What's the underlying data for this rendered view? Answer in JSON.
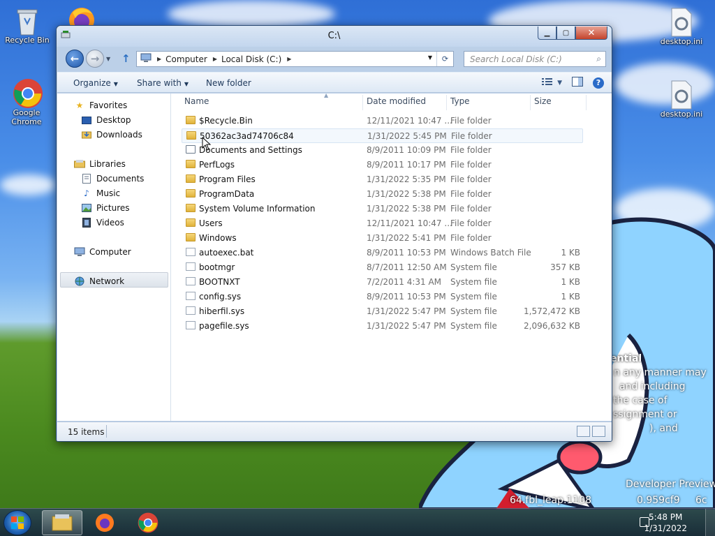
{
  "desktop": {
    "icons": [
      {
        "label": "Recycle Bin"
      },
      {
        "label": "Google Chrome"
      },
      {
        "label": "desktop.ini"
      },
      {
        "label": "desktop.ini"
      }
    ],
    "watermark": {
      "line1": "ential",
      "line2": "n any manner may",
      "line3": "and including",
      "line4": "the case of",
      "line5": "ssignment or",
      "line6": "), and",
      "line7": "Developer Preview",
      "line8": "64.fbl_leap.1108",
      "line9": "0.959cf9",
      "line10": "6c"
    }
  },
  "window": {
    "title": "C:\\",
    "address": {
      "crumbs": [
        "Computer",
        "Local Disk (C:)"
      ]
    },
    "search_placeholder": "Search Local Disk (C:)",
    "toolbar": {
      "organize": "Organize",
      "share_with": "Share with",
      "new_folder": "New folder"
    },
    "nav": {
      "favorites": "Favorites",
      "desktop": "Desktop",
      "downloads": "Downloads",
      "libraries": "Libraries",
      "documents": "Documents",
      "music": "Music",
      "pictures": "Pictures",
      "videos": "Videos",
      "computer": "Computer",
      "network": "Network"
    },
    "columns": {
      "name": "Name",
      "date": "Date modified",
      "type": "Type",
      "size": "Size"
    },
    "files": [
      {
        "name": "$Recycle.Bin",
        "date": "12/11/2021 10:47 ...",
        "type": "File folder",
        "size": "",
        "kind": "folder"
      },
      {
        "name": "50362ac3ad74706c84",
        "date": "1/31/2022 5:45 PM",
        "type": "File folder",
        "size": "",
        "kind": "folder"
      },
      {
        "name": "Documents and Settings",
        "date": "8/9/2011 10:09 PM",
        "type": "File folder",
        "size": "",
        "kind": "shortcut"
      },
      {
        "name": "PerfLogs",
        "date": "8/9/2011 10:17 PM",
        "type": "File folder",
        "size": "",
        "kind": "folder"
      },
      {
        "name": "Program Files",
        "date": "1/31/2022 5:35 PM",
        "type": "File folder",
        "size": "",
        "kind": "folder"
      },
      {
        "name": "ProgramData",
        "date": "1/31/2022 5:38 PM",
        "type": "File folder",
        "size": "",
        "kind": "folder"
      },
      {
        "name": "System Volume Information",
        "date": "1/31/2022 5:38 PM",
        "type": "File folder",
        "size": "",
        "kind": "folder"
      },
      {
        "name": "Users",
        "date": "12/11/2021 10:47 ...",
        "type": "File folder",
        "size": "",
        "kind": "folder"
      },
      {
        "name": "Windows",
        "date": "1/31/2022 5:41 PM",
        "type": "File folder",
        "size": "",
        "kind": "folder"
      },
      {
        "name": "autoexec.bat",
        "date": "8/9/2011 10:53 PM",
        "type": "Windows Batch File",
        "size": "1 KB",
        "kind": "file"
      },
      {
        "name": "bootmgr",
        "date": "8/7/2011 12:50 AM",
        "type": "System file",
        "size": "357 KB",
        "kind": "file"
      },
      {
        "name": "BOOTNXT",
        "date": "7/2/2011 4:31 AM",
        "type": "System file",
        "size": "1 KB",
        "kind": "file"
      },
      {
        "name": "config.sys",
        "date": "8/9/2011 10:53 PM",
        "type": "System file",
        "size": "1 KB",
        "kind": "file"
      },
      {
        "name": "hiberfil.sys",
        "date": "1/31/2022 5:47 PM",
        "type": "System file",
        "size": "1,572,472 KB",
        "kind": "file"
      },
      {
        "name": "pagefile.sys",
        "date": "1/31/2022 5:47 PM",
        "type": "System file",
        "size": "2,096,632 KB",
        "kind": "file"
      }
    ],
    "status": "15 items"
  },
  "taskbar": {
    "time": "5:48 PM",
    "date": "1/31/2022"
  }
}
